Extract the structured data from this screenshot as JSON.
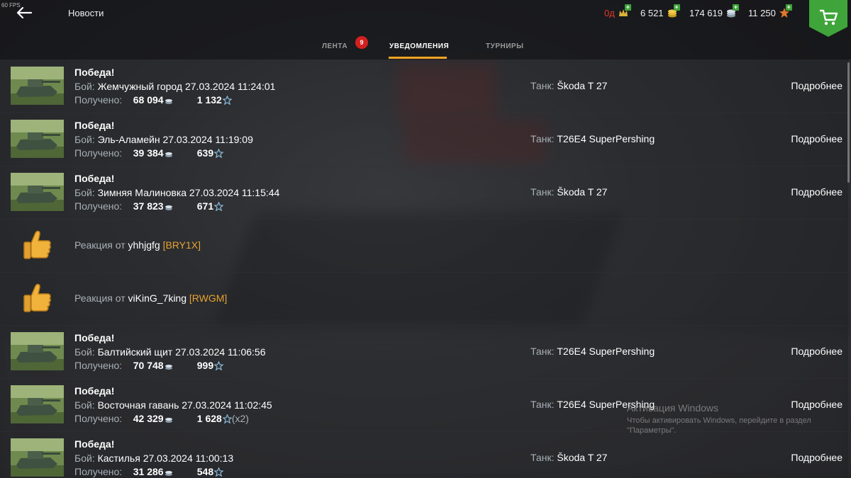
{
  "fps": "60 FPS",
  "header": {
    "title": "Новости",
    "currencies": {
      "days": "0д",
      "gold": "6 521",
      "credits": "174 619",
      "free_xp": "11 250"
    }
  },
  "tabs": [
    {
      "label": "ЛЕНТА",
      "badge": "9"
    },
    {
      "label": "УВЕДОМЛЕНИЯ",
      "active": true
    },
    {
      "label": "ТУРНИРЫ"
    }
  ],
  "labels": {
    "victory": "Победа!",
    "battle_prefix": "Бой:",
    "received": "Получено:",
    "tank_prefix": "Танк:",
    "details": "Подробнее",
    "reaction_prefix": "Реакция от"
  },
  "notifications": [
    {
      "type": "battle",
      "map": "Жемчужный город",
      "datetime": "27.03.2024 11:24:01",
      "credits": "68 094",
      "xp": "1 132",
      "tank": "Škoda T 27"
    },
    {
      "type": "battle",
      "map": "Эль-Аламейн",
      "datetime": "27.03.2024 11:19:09",
      "credits": "39 384",
      "xp": "639",
      "tank": "T26E4 SuperPershing"
    },
    {
      "type": "battle",
      "map": "Зимняя Малиновка",
      "datetime": "27.03.2024 11:15:44",
      "credits": "37 823",
      "xp": "671",
      "tank": "Škoda T 27"
    },
    {
      "type": "reaction",
      "user": "yhhjgfg",
      "clan": "[BRY1X]"
    },
    {
      "type": "reaction",
      "user": "viKinG_7king",
      "clan": "[RWGM]"
    },
    {
      "type": "battle",
      "map": "Балтийский щит",
      "datetime": "27.03.2024 11:06:56",
      "credits": "70 748",
      "xp": "999",
      "tank": "T26E4 SuperPershing"
    },
    {
      "type": "battle",
      "map": "Восточная гавань",
      "datetime": "27.03.2024 11:02:45",
      "credits": "42 329",
      "xp": "1 628",
      "xp_mult": "(x2)",
      "tank": "T26E4 SuperPershing"
    },
    {
      "type": "battle",
      "map": "Кастилья",
      "datetime": "27.03.2024 11:00:13",
      "credits": "31 286",
      "xp": "548",
      "tank": "Škoda T 27"
    }
  ],
  "watermark": {
    "title": "Активация Windows",
    "subtitle": "Чтобы активировать Windows, перейдите в раздел \"Параметры\"."
  },
  "colors": {
    "accent": "#f2a522",
    "badge": "#d3201f",
    "shop": "#3fa43a",
    "clan_tag": "#e8a330",
    "days_low": "#e03a2b"
  },
  "icons": {
    "back": "arrow-left-icon",
    "shop": "cart-icon",
    "credits": "credits-coin-icon",
    "xp": "xp-star-icon",
    "reaction": "thumbs-up-icon"
  }
}
